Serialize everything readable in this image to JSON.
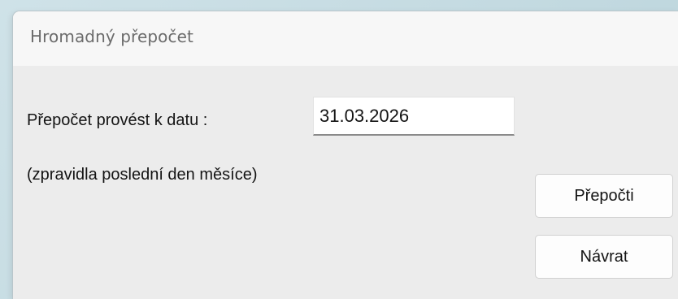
{
  "window": {
    "title": "Hromadný přepočet"
  },
  "form": {
    "date_label": "Přepočet provést k datu :",
    "date_value": "31.03.2026",
    "hint": "(zpravidla poslední den měsíce)"
  },
  "buttons": {
    "recalculate_label": "Přepočti",
    "return_label": "Návrat"
  }
}
